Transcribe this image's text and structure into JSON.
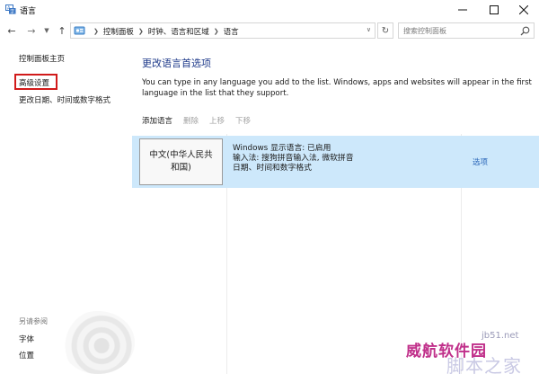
{
  "window": {
    "title": "语言"
  },
  "address": {
    "crumbs": [
      "控制面板",
      "时钟、语言和区域",
      "语言"
    ]
  },
  "search": {
    "placeholder": "搜索控制面板"
  },
  "left": {
    "home": "控制面板主页",
    "advanced": "高级设置",
    "datetime": "更改日期、时间或数字格式",
    "see_also": "另请参阅",
    "fonts": "字体",
    "location": "位置"
  },
  "main": {
    "heading": "更改语言首选项",
    "description": "You can type in any language you add to the list. Windows, apps and websites will appear in the first language in the list that they support.",
    "toolbar": {
      "add": "添加语言",
      "remove": "删除",
      "up": "上移",
      "down": "下移"
    },
    "language": {
      "name": "中文(中华人民共和国)",
      "line1": "Windows 显示语言: 已启用",
      "line2": "输入法: 搜狗拼音输入法, 微软拼音",
      "line3": "日期、时间和数字格式",
      "options": "选项"
    }
  },
  "watermark": {
    "brand": "威航软件园",
    "url": "jb51.net",
    "site": "脚本之家"
  },
  "colors": {
    "selection": "#cde8fb",
    "link": "#2a66b8",
    "heading": "#1e3a8a",
    "highlight_box": "#d11a1a"
  }
}
